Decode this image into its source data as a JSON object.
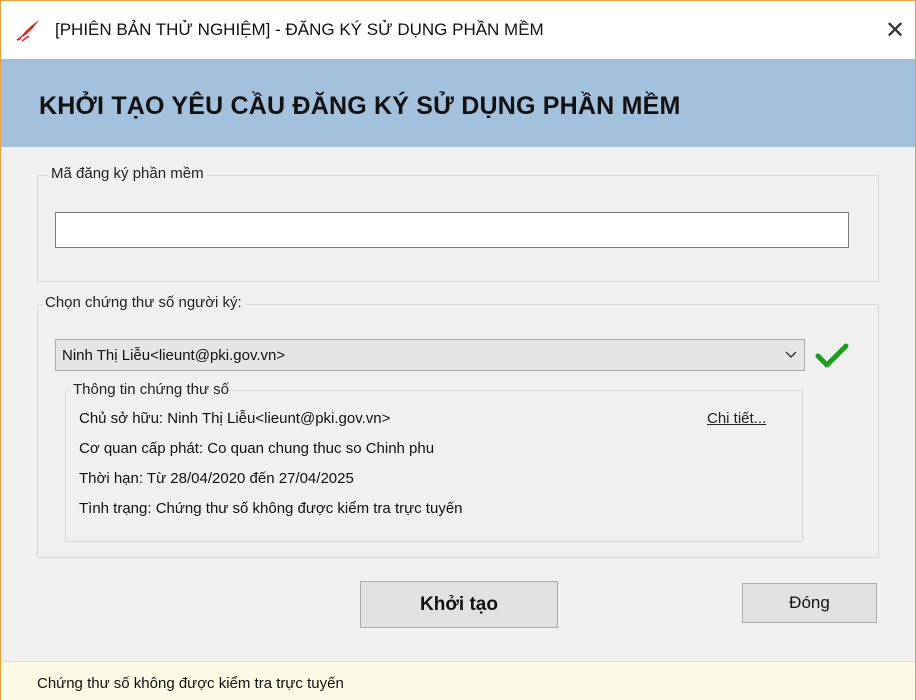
{
  "window": {
    "title": "[PHIÊN BẢN THỬ NGHIỆM] - ĐĂNG KÝ SỬ DỤNG PHẦN MỀM",
    "close_glyph": "✕",
    "app_icon": "red-quill-signature-icon"
  },
  "header": {
    "title": "KHỞI TẠO YÊU CẦU ĐĂNG KÝ SỬ DỤNG PHẦN MỀM",
    "background": "#a3c0dc"
  },
  "registration": {
    "group_label": "Mã đăng ký phần mềm",
    "code_value": "",
    "code_placeholder": ""
  },
  "certificate": {
    "group_label": "Chọn chứng thư số người ký:",
    "selected": "Ninh Thị Liễu<lieunt@pki.gov.vn>",
    "valid_icon": "green-check-icon",
    "info": {
      "group_label": "Thông tin chứng thư số",
      "owner": "Chủ sở hữu: Ninh Thị Liễu<lieunt@pki.gov.vn>",
      "issuer": "Cơ quan cấp phát: Co quan chung thuc so Chinh phu",
      "validity": "Thời hạn: Từ 28/04/2020 đến 27/04/2025",
      "status": "Tình trạng: Chứng thư số không được kiểm tra trực tuyến",
      "detail_link": "Chi tiết..."
    }
  },
  "buttons": {
    "create": "Khởi tạo",
    "close": "Đóng"
  },
  "statusbar": {
    "text": "Chứng thư số không được kiểm tra trực tuyến"
  },
  "colors": {
    "window_border": "#e8a13c",
    "status_bg": "#fdfbe6",
    "check_green": "#1e9e1e"
  }
}
